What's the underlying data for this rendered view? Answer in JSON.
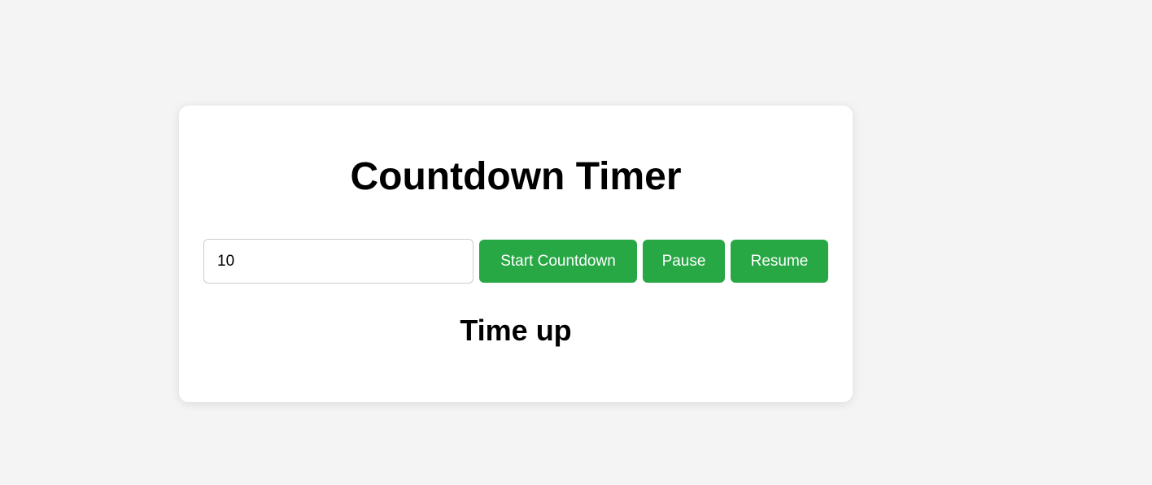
{
  "timer": {
    "title": "Countdown Timer",
    "input_value": "10",
    "status": "Time up"
  },
  "buttons": {
    "start_label": "Start Countdown",
    "pause_label": "Pause",
    "resume_label": "Resume"
  },
  "colors": {
    "page_background": "#f4f4f4",
    "card_background": "#ffffff",
    "button_green": "#28a745",
    "button_text": "#ffffff"
  }
}
